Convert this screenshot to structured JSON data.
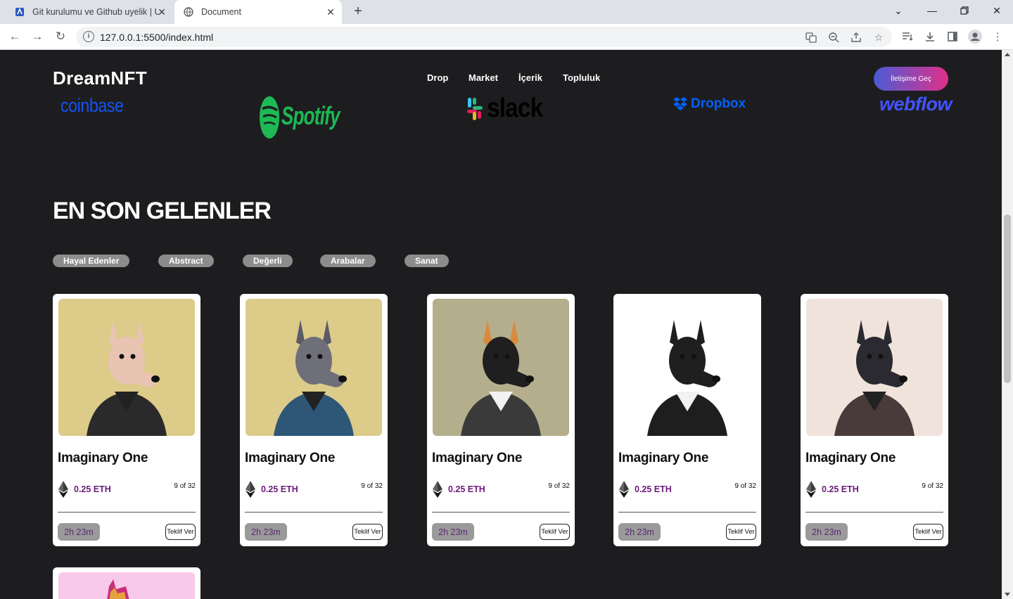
{
  "browser": {
    "tabs": [
      {
        "title": "Git kurulumu ve Github uyelik | U",
        "active": false
      },
      {
        "title": "Document",
        "active": true
      }
    ],
    "url": "127.0.0.1:5500/index.html"
  },
  "header": {
    "logo": "DreamNFT",
    "nav": [
      "Drop",
      "Market",
      "İçerik",
      "Topluluk"
    ],
    "cta": "İletişime Geç"
  },
  "brands": [
    "coinbase",
    "Spotify",
    "slack",
    "Dropbox",
    "webflow"
  ],
  "section": {
    "title": "EN SON GELENLER",
    "categories": [
      "Hayal Edenler",
      "Abstract",
      "Değerli",
      "Arabalar",
      "Sanat"
    ]
  },
  "cards": [
    {
      "title": "Imaginary One",
      "price": "0.25 ETH",
      "edition": "9 of 32",
      "timer": "2h 23m",
      "action": "Teklif Ver",
      "bg": "#dccb89"
    },
    {
      "title": "Imaginary One",
      "price": "0.25 ETH",
      "edition": "9 of 32",
      "timer": "2h 23m",
      "action": "Teklif Ver",
      "bg": "#dccb89"
    },
    {
      "title": "Imaginary One",
      "price": "0.25 ETH",
      "edition": "9 of 32",
      "timer": "2h 23m",
      "action": "Teklif Ver",
      "bg": "#b5ae8c"
    },
    {
      "title": "Imaginary One",
      "price": "0.25 ETH",
      "edition": "9 of 32",
      "timer": "2h 23m",
      "action": "Teklif Ver",
      "bg": "#ffffff"
    },
    {
      "title": "Imaginary One",
      "price": "0.25 ETH",
      "edition": "9 of 32",
      "timer": "2h 23m",
      "action": "Teklif Ver",
      "bg": "#efe3dc"
    }
  ],
  "colors": {
    "page_bg": "#1d1d20",
    "price": "#6b1a7a",
    "chip": "#8c8c8c",
    "cta_from": "#4a5bd4",
    "cta_to": "#e0308a"
  }
}
